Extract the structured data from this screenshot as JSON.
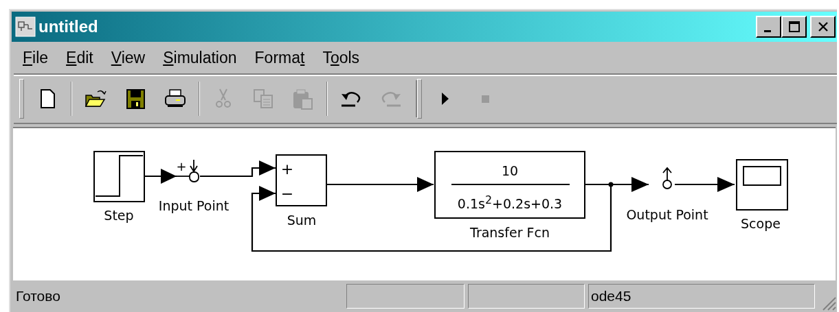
{
  "window": {
    "title": "untitled"
  },
  "menu": [
    {
      "key": "F",
      "rest": "ile"
    },
    {
      "key": "E",
      "rest": "dit"
    },
    {
      "key": "V",
      "rest": "iew"
    },
    {
      "key": "S",
      "rest": "imulation"
    },
    {
      "pre": "Forma",
      "key": "t"
    },
    {
      "pre": "T",
      "key": "o",
      "rest": "ols"
    }
  ],
  "toolbar": [
    {
      "kind": "new",
      "disabled": false
    },
    {
      "kind": "sep"
    },
    {
      "kind": "open",
      "disabled": false
    },
    {
      "kind": "save",
      "disabled": false
    },
    {
      "kind": "print",
      "disabled": false
    },
    {
      "kind": "sep"
    },
    {
      "kind": "cut",
      "disabled": true
    },
    {
      "kind": "copy",
      "disabled": true
    },
    {
      "kind": "paste",
      "disabled": true
    },
    {
      "kind": "sep"
    },
    {
      "kind": "undo",
      "disabled": false
    },
    {
      "kind": "redo",
      "disabled": true
    },
    {
      "kind": "grip"
    },
    {
      "kind": "run",
      "disabled": false
    },
    {
      "kind": "stop",
      "disabled": true
    }
  ],
  "diagram": {
    "blocks": [
      {
        "kind": "step",
        "label": "Step"
      },
      {
        "kind": "input_point",
        "label": "Input Point",
        "sign": "+"
      },
      {
        "kind": "sum",
        "label": "Sum",
        "signs": [
          "+",
          "−"
        ]
      },
      {
        "kind": "transfer",
        "label": "Transfer Fcn",
        "numerator": "10",
        "denominator": "0.1s$^{2}$+0.2s+0.3"
      },
      {
        "kind": "output_point",
        "label": "Output Point"
      },
      {
        "kind": "scope",
        "label": "Scope"
      }
    ]
  },
  "status_bar": {
    "message": "Готово",
    "panels": [
      {
        "kind": "empty"
      },
      {
        "kind": "empty"
      },
      {
        "kind": "text",
        "text": "ode45"
      }
    ]
  }
}
